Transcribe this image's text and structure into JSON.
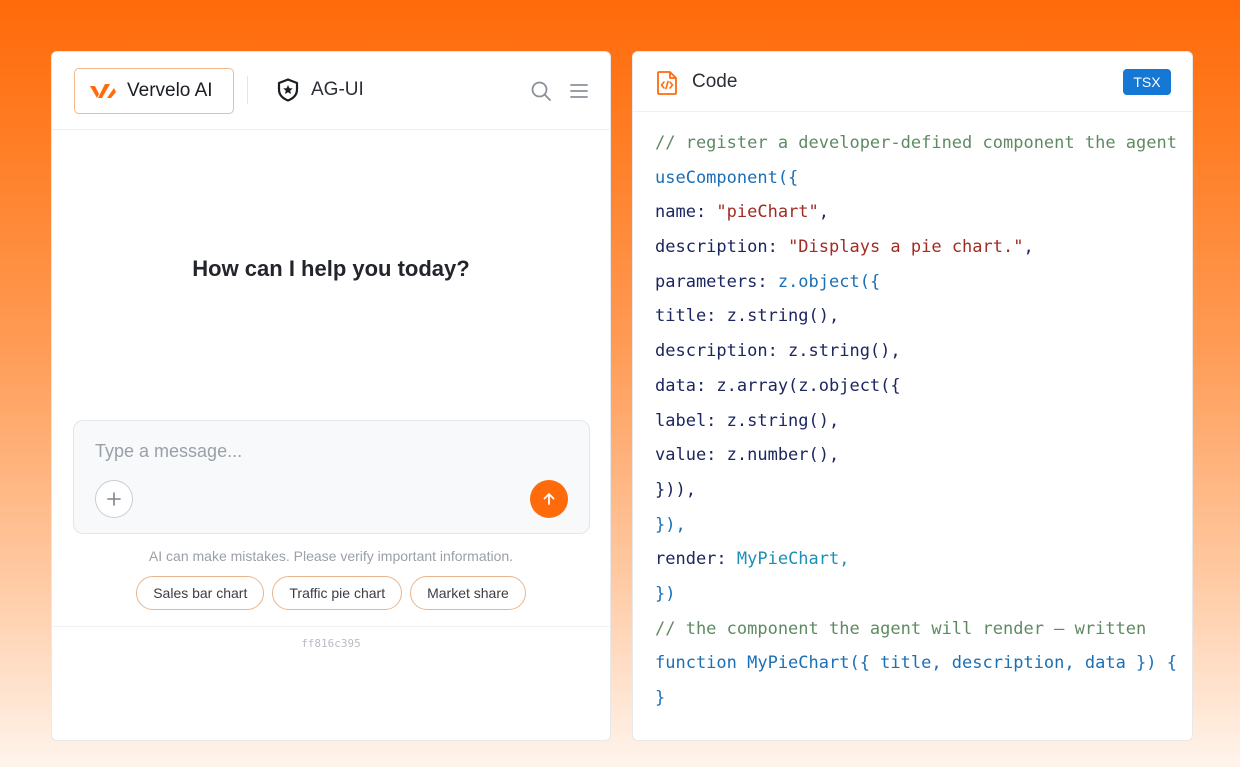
{
  "chat": {
    "brand_label": "Vervelo AI",
    "protocol_label": "AG-UI",
    "welcome": "How can I help you today?",
    "input_placeholder": "Type a message...",
    "disclaimer": "AI can make mistakes. Please verify important information.",
    "suggestions": [
      "Sales bar chart",
      "Traffic pie chart",
      "Market share"
    ],
    "build_hash": "ff816c395"
  },
  "code_panel": {
    "title": "Code",
    "language": "TSX",
    "lines": [
      [
        {
          "t": "// register a developer-defined component the agent",
          "c": "comment"
        }
      ],
      [
        {
          "t": "useComponent({",
          "c": "fn"
        }
      ],
      [
        {
          "t": "name: ",
          "c": "key"
        },
        {
          "t": "\"pieChart\"",
          "c": "str"
        },
        {
          "t": ",",
          "c": "punc"
        }
      ],
      [
        {
          "t": "description: ",
          "c": "key"
        },
        {
          "t": "\"Displays a pie chart.\"",
          "c": "str"
        },
        {
          "t": ",",
          "c": "punc"
        }
      ],
      [
        {
          "t": "parameters: ",
          "c": "key"
        },
        {
          "t": "z.object({",
          "c": "fn"
        }
      ],
      [
        {
          "t": "title: z.string(),",
          "c": "key"
        }
      ],
      [
        {
          "t": "description: z.string(),",
          "c": "key"
        }
      ],
      [
        {
          "t": "data: z.array(z.object({",
          "c": "key"
        }
      ],
      [
        {
          "t": "label: z.string(),",
          "c": "key"
        }
      ],
      [
        {
          "t": "value: z.number(),",
          "c": "key"
        }
      ],
      [
        {
          "t": "})),",
          "c": "key"
        }
      ],
      [
        {
          "t": "}),",
          "c": "fn"
        }
      ],
      [
        {
          "t": "render: ",
          "c": "key"
        },
        {
          "t": "MyPieChart,",
          "c": "type"
        }
      ],
      [
        {
          "t": "})",
          "c": "fn"
        }
      ],
      [
        {
          "t": "// the component the agent will render – written",
          "c": "comment"
        }
      ],
      [
        {
          "t": "function MyPieChart({ title, description, data }) {",
          "c": "fn"
        }
      ],
      [
        {
          "t": "}",
          "c": "fn"
        }
      ]
    ]
  },
  "colors": {
    "accent": "#ff6a0a",
    "badge": "#1478d4"
  },
  "icons": [
    "vervelo-logo-icon",
    "shield-star-icon",
    "search-icon",
    "menu-icon",
    "plus-icon",
    "arrow-up-icon",
    "code-file-icon"
  ]
}
